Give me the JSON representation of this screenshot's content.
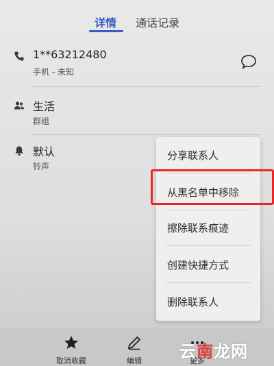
{
  "tabs": {
    "details": "详情",
    "call_log": "通话记录"
  },
  "contact": {
    "phone": "1**63212480",
    "phone_type": "手机 - 未知",
    "group_name": "生活",
    "group_label": "群组",
    "ringtone_name": "默认",
    "ringtone_label": "铃声"
  },
  "menu": {
    "items": [
      {
        "label": "分享联系人"
      },
      {
        "label": "从黑名单中移除"
      },
      {
        "label": "擦除联系痕迹"
      },
      {
        "label": "创建快捷方式"
      },
      {
        "label": "删除联系人"
      }
    ],
    "highlighted_index": 1
  },
  "bottom_bar": {
    "items": [
      {
        "label": "取消收藏",
        "icon": "star-icon"
      },
      {
        "label": "编辑",
        "icon": "pencil-icon"
      },
      {
        "label": "更多",
        "icon": "more-icon"
      }
    ]
  },
  "watermark": {
    "text_white": "云",
    "text_red": "南",
    "text_rest": "龙网"
  },
  "colors": {
    "accent": "#3a5bc7",
    "highlight": "#ea2424"
  }
}
